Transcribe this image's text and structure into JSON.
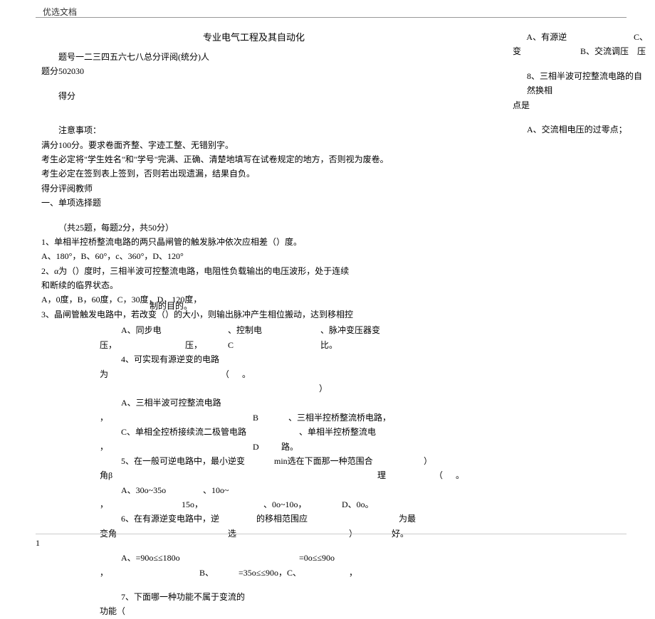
{
  "header": {
    "label": "优选文档"
  },
  "title": "专业电气工程及其自动化",
  "left": {
    "line1": "题号一二三四五六七八总分评阅(统分)人",
    "line2": "题分502030",
    "line3": "得分",
    "notice_title": "注意事项：",
    "notice1": "满分100分。要求卷面齐整、字迹工整、无错别字。",
    "notice2": "考生必定将\"学生姓名\"和\"学号\"完满、正确、清楚地填写在试卷规定的地方，否则视为废卷。",
    "notice3": "考生必定在签到表上签到，否则若出现遗漏，结果自负。",
    "score_line": "得分评阅教师",
    "section1": "一、单项选择题",
    "q_intro": "（共25题，每题2分，共50分）",
    "q1": "1、单相半控桥整流电路的两只晶闸管的触发脉冲依次应相差（）度。",
    "q1_opts": "A、180°，B、60°，c、360°，D、120°",
    "q2": "2、α为（）度时，三相半波可控整流电路，电阻性负载输出的电压波形，处于连续",
    "q2_cont": "和断续的临界状态。",
    "q2_opts": "A，0度，B，60度，C，30度，D，120度，",
    "q3": "3、晶闸管触发电路中，若改变（）的大小，则输出脉冲产生相位搬动，达到移相控"
  },
  "mid": {
    "q3_cont": "制的目的。",
    "q3a": "A、同步电",
    "q3b": "、控制电",
    "q3c": "、脉冲变压器变",
    "q3_r2a": "压，",
    "q3_r2b": "压，",
    "q3_r2c": "C",
    "q3_r2d": "比。",
    "q4": "4、可实现有源逆变的电路",
    "q4_r2a": "为",
    "q4_r2b": "（",
    "q4_r2c": "。",
    "q4_spacer": "）",
    "q4a": "A、三相半波可控整流电路",
    "q4b_pre": "，",
    "q4b_lbl": "B",
    "q4b": "、三相半控桥整流桥电路，",
    "q4c": "C、单相全控桥接续流二极管电路",
    "q4d": "、单相半控桥整流电",
    "q4d_r2a": "，",
    "q4d_r2b": "D",
    "q4d_r2c": "路。",
    "q5": "5、在一般可逆电路中，最小逆变",
    "q5_b": "min选在下面那一种范围合",
    "q5_c": "）",
    "q5_r2a": "角β",
    "q5_r2b": "理",
    "q5_r2c": "（",
    "q5_r2d": "。",
    "q5a": "A、30o~35o",
    "q5b_pre": "，",
    "q5b": "、10o~",
    "q5_r4a": "，",
    "q5_r4b": "15o，",
    "q5_r4c": "、0o~10o，",
    "q5_r4d": "D、0o。",
    "q6": "6、在有源逆变电路中，逆",
    "q6_b": "的移相范围应",
    "q6_c": "为最",
    "q6_r2a": "变角",
    "q6_r2b": "选",
    "q6_r2c": "）",
    "q6_r2d": "好。",
    "q6a": "A、=90o≤≤180o",
    "q6b_mid": "=0o≤≤90o",
    "q6_r4a": "，",
    "q6_r4b": "B、",
    "q6_r4c": "=35o≤≤90o，C、",
    "q6_r4d": "，",
    "q7": "7、下面哪一种功能不属于变流的",
    "q7_r2": "功能（",
    "q7_r3": ""
  },
  "right": {
    "q7a": "A、有源逆",
    "q7a_end": "C、",
    "q7_r2a": "变",
    "q7_r2b": "B、交流调压",
    "q7_r2c": "压",
    "q8": "8、三相半波可控整流电路的自然换相",
    "q8_cont": "点是",
    "q8a": "A、交流相电压的过零点；"
  },
  "footer": {
    "page": "1"
  }
}
